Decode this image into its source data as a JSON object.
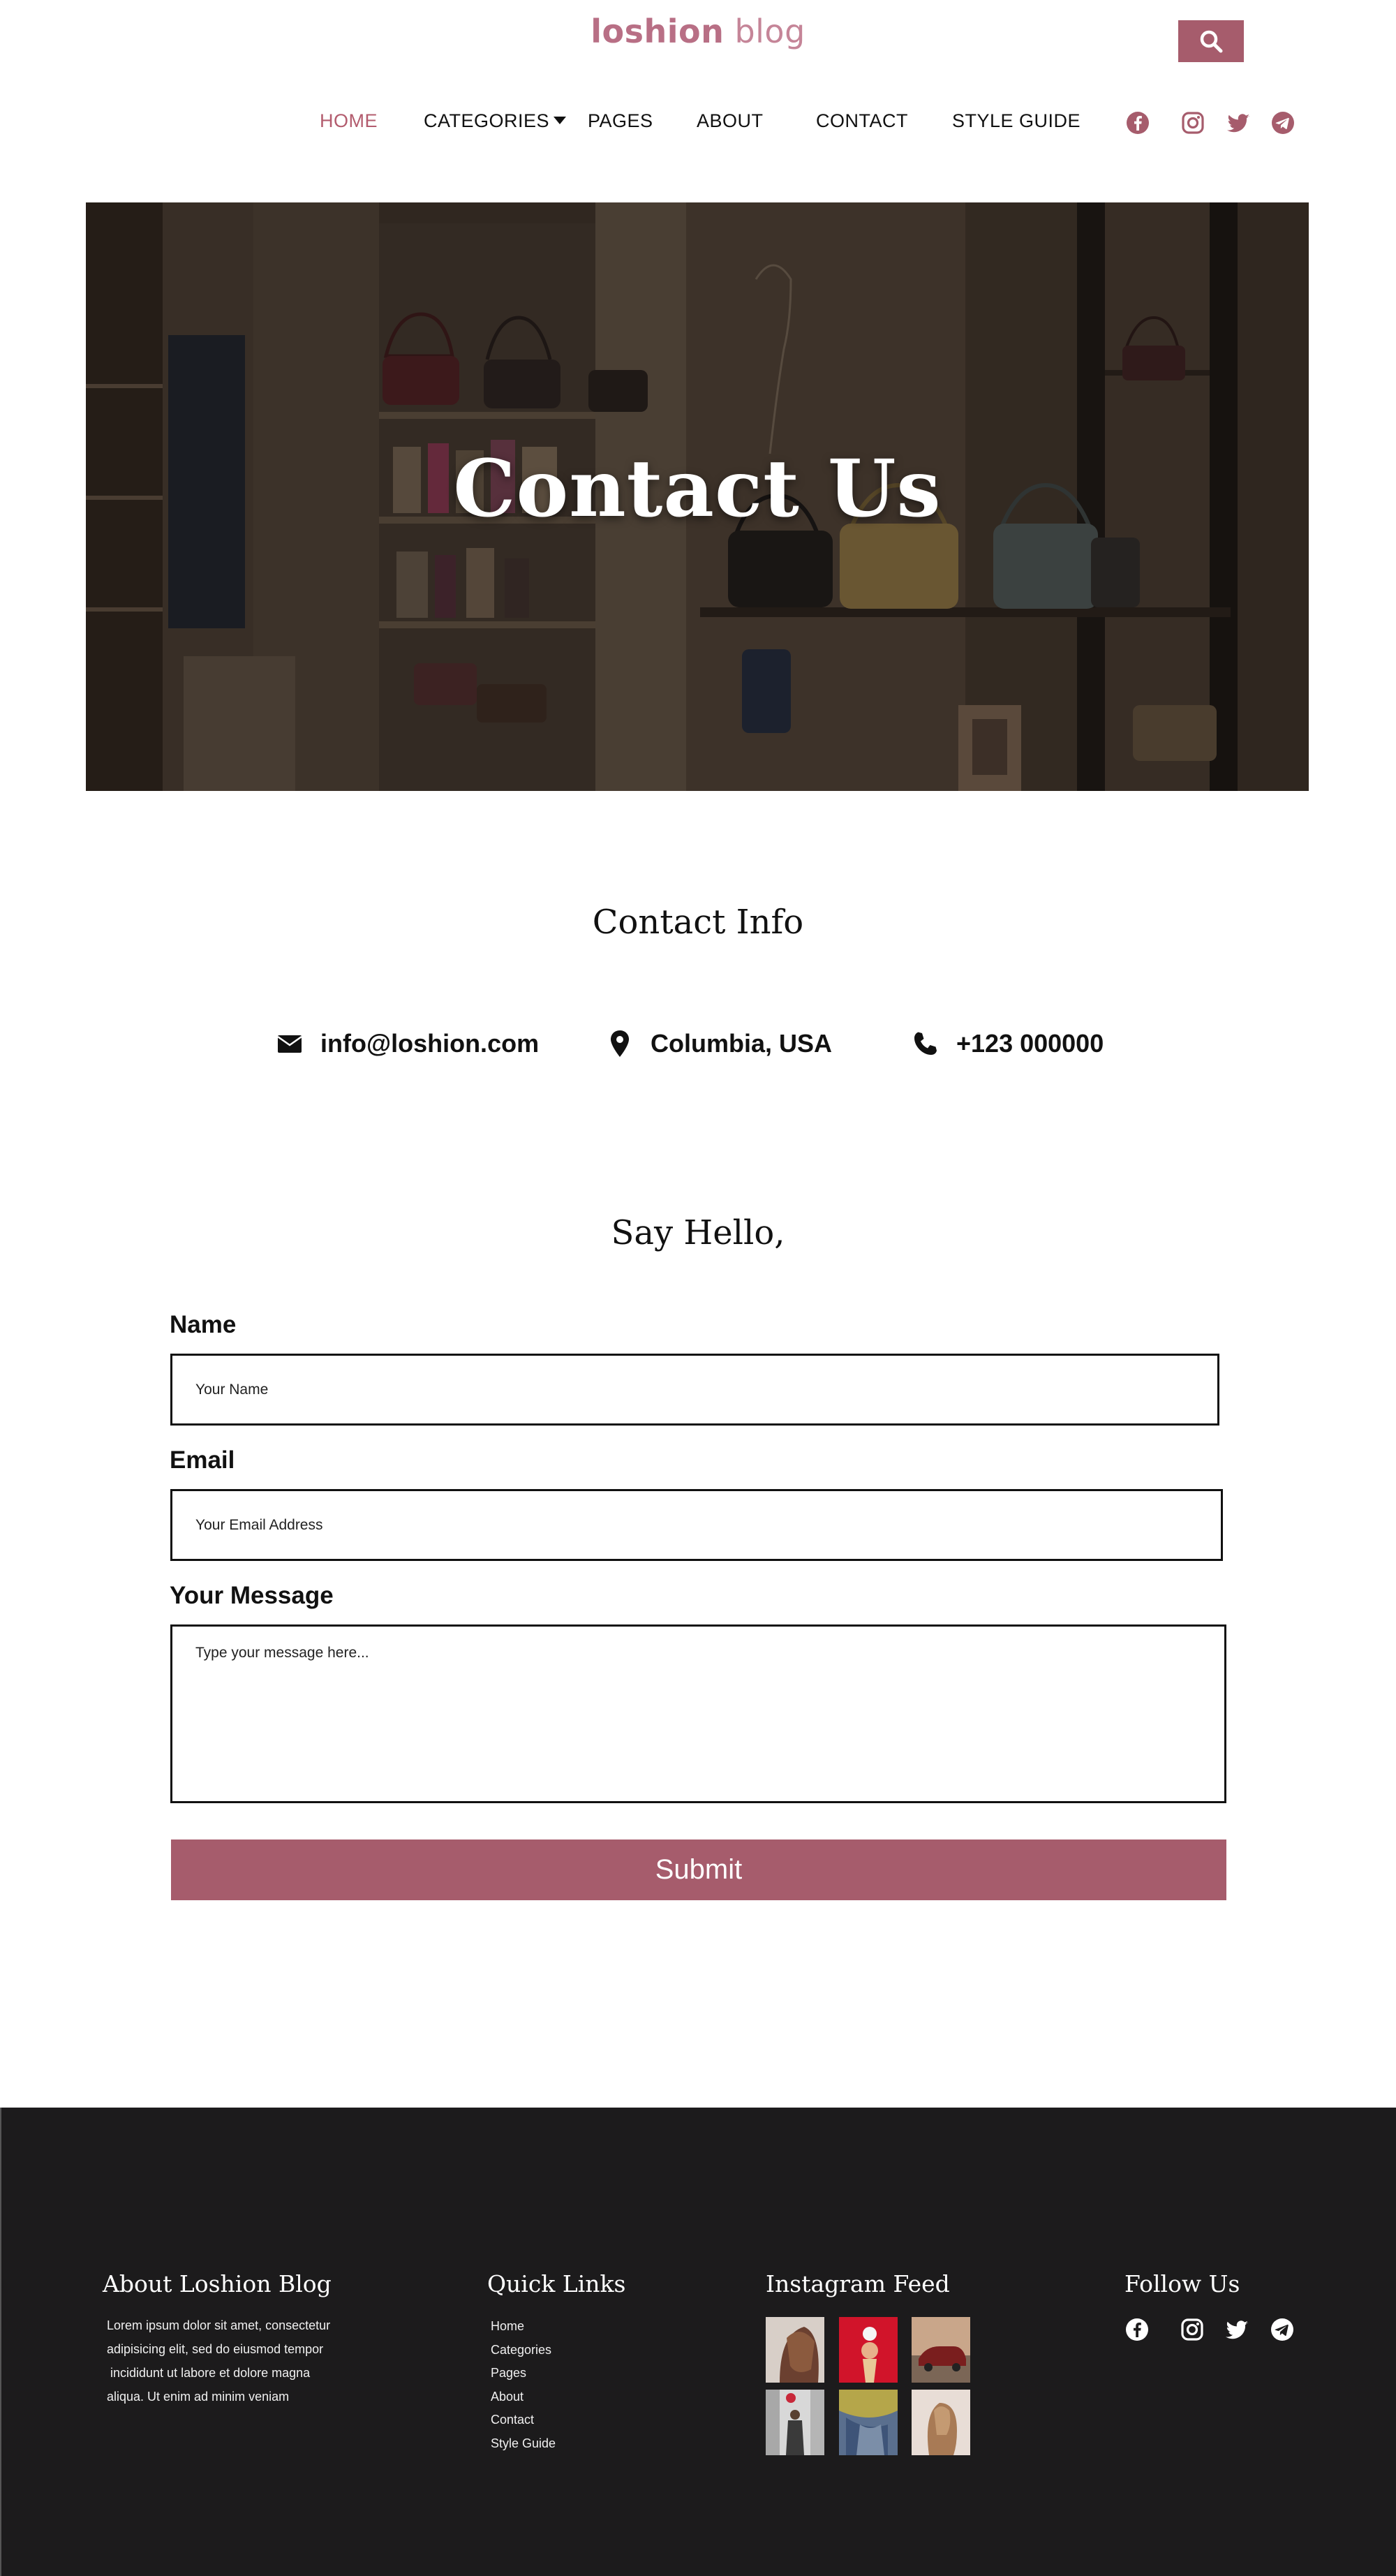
{
  "header": {
    "logo_bold": "loshion",
    "logo_light": " blog",
    "nav": [
      {
        "label": "HOME",
        "active": true
      },
      {
        "label": "CATEGORIES",
        "has_dropdown": true
      },
      {
        "label": "PAGES"
      },
      {
        "label": "ABOUT"
      },
      {
        "label": "CONTACT"
      },
      {
        "label": "STYLE GUIDE"
      }
    ],
    "social_icons": [
      "facebook-icon",
      "instagram-icon",
      "twitter-icon",
      "telegram-icon"
    ],
    "accent_color": "#a65c6c"
  },
  "hero": {
    "title": "Contact Us"
  },
  "contact_info": {
    "title": "Contact Info",
    "email": "info@loshion.com",
    "location": "Columbia, USA",
    "phone": "+123 000000"
  },
  "form": {
    "title": "Say Hello,",
    "name_label": "Name",
    "name_placeholder": "Your Name",
    "email_label": "Email",
    "email_placeholder": "Your Email Address",
    "message_label": "Your Message",
    "message_placeholder": "Type your message here...",
    "submit_label": "Submit"
  },
  "footer": {
    "about_title": "About Loshion Blog",
    "about_lines": [
      "Lorem ipsum dolor sit amet, consectetur",
      "adipisicing elit, sed do eiusmod tempor",
      " incididunt ut labore et dolore magna",
      "aliqua. Ut enim ad minim veniam"
    ],
    "links_title": "Quick Links",
    "links": [
      "Home",
      "Categories",
      "Pages",
      "About",
      "Contact",
      "Style Guide"
    ],
    "instagram_title": "Instagram Feed",
    "follow_title": "Follow Us",
    "background_color": "#1c1b1c"
  }
}
